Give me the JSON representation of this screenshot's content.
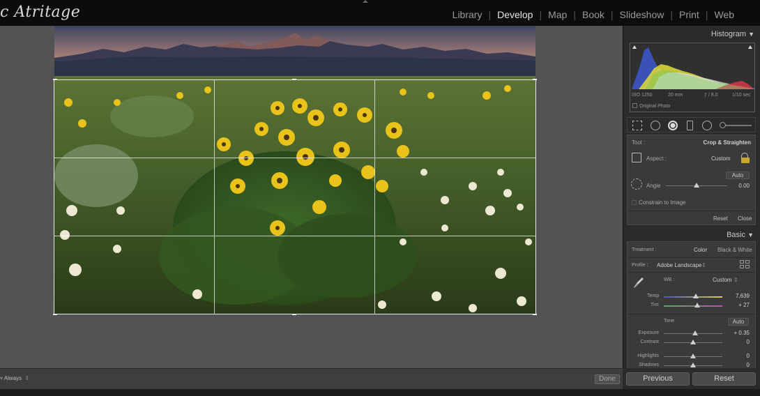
{
  "topbar": {
    "logo": "c Atritage",
    "modules": [
      {
        "label": "Library",
        "active": false
      },
      {
        "label": "Develop",
        "active": true
      },
      {
        "label": "Map",
        "active": false
      },
      {
        "label": "Book",
        "active": false
      },
      {
        "label": "Slideshow",
        "active": false
      },
      {
        "label": "Print",
        "active": false
      },
      {
        "label": "Web",
        "active": false
      }
    ],
    "separator": "|"
  },
  "toolbar": {
    "overlay_value": "Always",
    "overlay_arrow": "⇕",
    "done_label": "Done"
  },
  "histogram": {
    "title": "Histogram",
    "iso": "ISO 1250",
    "focal": "20 mm",
    "aperture": "ƒ / 8.0",
    "shutter": "1/10 sec",
    "original_photo": "Original Photo"
  },
  "crop": {
    "tool_label": "Tool :",
    "tool_name": "Crop & Straighten",
    "aspect_label": "Aspect :",
    "aspect_value": "Custom",
    "auto_label": "Auto",
    "angle_label": "Angle",
    "angle_value": "0.00",
    "angle_position": 0.5,
    "constrain_label": "Constrain to Image",
    "reset_label": "Reset",
    "close_label": "Close"
  },
  "basic": {
    "title": "Basic",
    "treatment_label": "Treatment :",
    "treatment_color": "Color",
    "treatment_bw": "Black & White",
    "profile_label": "Profile :",
    "profile_value": "Adobe Landscape",
    "wb_label": "WB :",
    "wb_value": "Custom",
    "temp_label": "Temp",
    "temp_value": "7,639",
    "temp_position": 0.55,
    "tint_label": "Tint",
    "tint_value": "+ 27",
    "tint_position": 0.57,
    "tone_label": "Tone",
    "tone_auto": "Auto",
    "sliders": [
      {
        "label": "Exposure",
        "value": "+ 0.35",
        "position": 0.53
      },
      {
        "label": "Contrast",
        "value": "0",
        "position": 0.5
      },
      {
        "label": "Highlights",
        "value": "0",
        "position": 0.5
      },
      {
        "label": "Shadows",
        "value": "0",
        "position": 0.5
      }
    ]
  },
  "bottom_buttons": {
    "previous": "Previous",
    "reset": "Reset"
  },
  "colors": {
    "active_module": "#e6e6e6",
    "inactive_module": "#9a9a9a",
    "panel_bg": "#3a3a3a",
    "canvas_bg": "#535353"
  }
}
